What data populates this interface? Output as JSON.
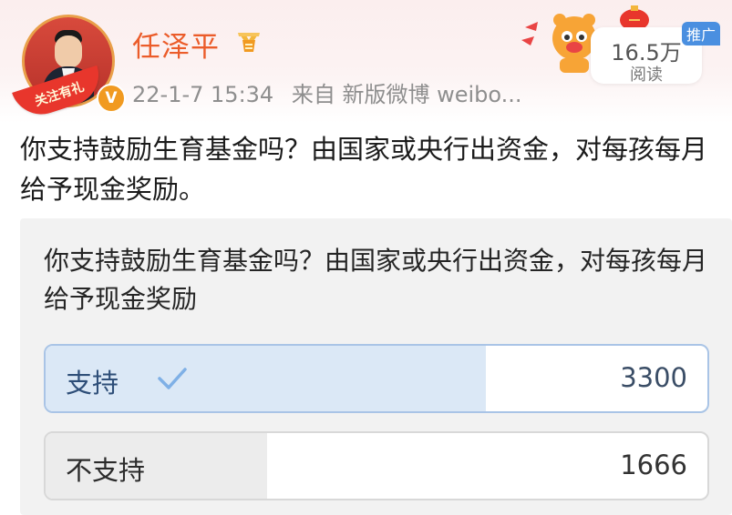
{
  "user": {
    "name": "任泽平",
    "avatar_ribbon": "关注有礼",
    "verified_badge": "V"
  },
  "post_meta": {
    "time": "22-1-7 15:34",
    "source": "来自 新版微博 weibo..."
  },
  "reads": {
    "count": "16.5万",
    "label": "阅读"
  },
  "promo_badge": "推广",
  "post": {
    "text": "你支持鼓励生育基金吗？由国家或央行出资金，对每孩每月给予现金奖励。"
  },
  "poll": {
    "question": "你支持鼓励生育基金吗？由国家或央行出资金，对每孩每月给予现金奖励",
    "options": [
      {
        "label": "支持",
        "count": "3300",
        "selected": true,
        "share": 0.665
      },
      {
        "label": "不支持",
        "count": "1666",
        "selected": false,
        "share": 0.335
      }
    ]
  },
  "colors": {
    "username": "#eb5c2a",
    "promo_badge": "#4a8fe0",
    "selected_fill": "#dbe8f6",
    "check": "#7fb0e6"
  },
  "icons": [
    "medal-icon",
    "verified-icon",
    "check-icon",
    "tiger-mascot-icon",
    "lantern-icon",
    "firecracker-icon"
  ]
}
